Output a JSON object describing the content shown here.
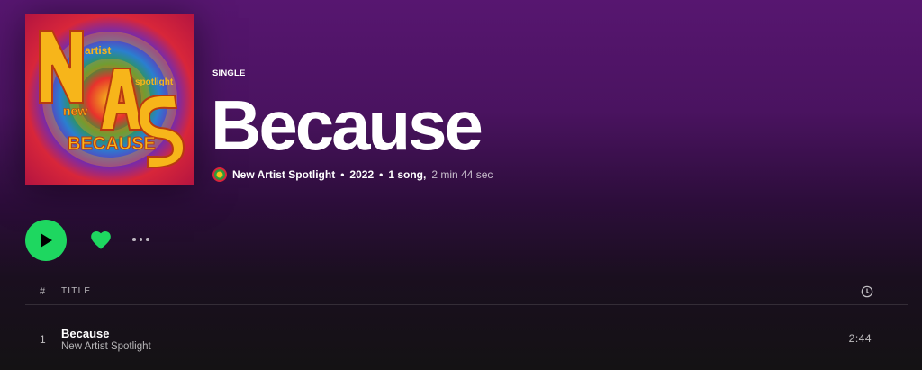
{
  "album": {
    "type_label": "SINGLE",
    "title": "Because",
    "artist": "New Artist Spotlight",
    "year": "2022",
    "song_count": "1 song,",
    "duration": "2 min 44 sec",
    "separator": "•",
    "cover_lettering": [
      "N",
      "A",
      "S",
      "artist",
      "spotlight",
      "new",
      "BECAUSE"
    ]
  },
  "actions": {
    "play_icon": "play-icon",
    "like_icon": "heart-icon",
    "more_icon": "more-options-icon"
  },
  "tracklist": {
    "header_number": "#",
    "header_title": "TITLE",
    "header_duration_icon": "clock-icon",
    "tracks": [
      {
        "number": "1",
        "title": "Because",
        "artist": "New Artist Spotlight",
        "duration": "2:44"
      }
    ]
  },
  "colors": {
    "accent": "#1ed760",
    "header_bg": "#571670"
  }
}
